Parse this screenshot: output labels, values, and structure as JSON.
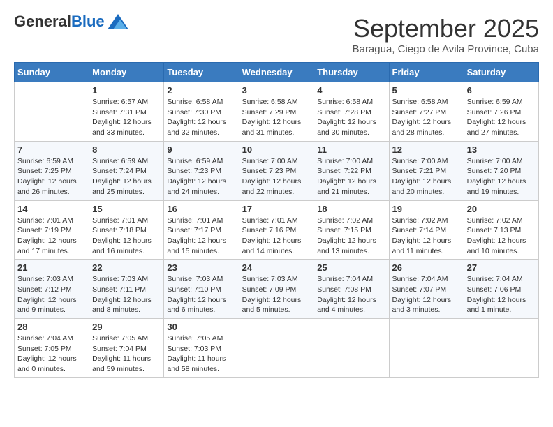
{
  "header": {
    "logo": {
      "general": "General",
      "blue": "Blue"
    },
    "title": "September 2025",
    "location": "Baragua, Ciego de Avila Province, Cuba"
  },
  "calendar": {
    "headers": [
      "Sunday",
      "Monday",
      "Tuesday",
      "Wednesday",
      "Thursday",
      "Friday",
      "Saturday"
    ],
    "weeks": [
      [
        {
          "day": "",
          "sunrise": "",
          "sunset": "",
          "daylight": ""
        },
        {
          "day": "1",
          "sunrise": "Sunrise: 6:57 AM",
          "sunset": "Sunset: 7:31 PM",
          "daylight": "Daylight: 12 hours and 33 minutes."
        },
        {
          "day": "2",
          "sunrise": "Sunrise: 6:58 AM",
          "sunset": "Sunset: 7:30 PM",
          "daylight": "Daylight: 12 hours and 32 minutes."
        },
        {
          "day": "3",
          "sunrise": "Sunrise: 6:58 AM",
          "sunset": "Sunset: 7:29 PM",
          "daylight": "Daylight: 12 hours and 31 minutes."
        },
        {
          "day": "4",
          "sunrise": "Sunrise: 6:58 AM",
          "sunset": "Sunset: 7:28 PM",
          "daylight": "Daylight: 12 hours and 30 minutes."
        },
        {
          "day": "5",
          "sunrise": "Sunrise: 6:58 AM",
          "sunset": "Sunset: 7:27 PM",
          "daylight": "Daylight: 12 hours and 28 minutes."
        },
        {
          "day": "6",
          "sunrise": "Sunrise: 6:59 AM",
          "sunset": "Sunset: 7:26 PM",
          "daylight": "Daylight: 12 hours and 27 minutes."
        }
      ],
      [
        {
          "day": "7",
          "sunrise": "Sunrise: 6:59 AM",
          "sunset": "Sunset: 7:25 PM",
          "daylight": "Daylight: 12 hours and 26 minutes."
        },
        {
          "day": "8",
          "sunrise": "Sunrise: 6:59 AM",
          "sunset": "Sunset: 7:24 PM",
          "daylight": "Daylight: 12 hours and 25 minutes."
        },
        {
          "day": "9",
          "sunrise": "Sunrise: 6:59 AM",
          "sunset": "Sunset: 7:23 PM",
          "daylight": "Daylight: 12 hours and 24 minutes."
        },
        {
          "day": "10",
          "sunrise": "Sunrise: 7:00 AM",
          "sunset": "Sunset: 7:23 PM",
          "daylight": "Daylight: 12 hours and 22 minutes."
        },
        {
          "day": "11",
          "sunrise": "Sunrise: 7:00 AM",
          "sunset": "Sunset: 7:22 PM",
          "daylight": "Daylight: 12 hours and 21 minutes."
        },
        {
          "day": "12",
          "sunrise": "Sunrise: 7:00 AM",
          "sunset": "Sunset: 7:21 PM",
          "daylight": "Daylight: 12 hours and 20 minutes."
        },
        {
          "day": "13",
          "sunrise": "Sunrise: 7:00 AM",
          "sunset": "Sunset: 7:20 PM",
          "daylight": "Daylight: 12 hours and 19 minutes."
        }
      ],
      [
        {
          "day": "14",
          "sunrise": "Sunrise: 7:01 AM",
          "sunset": "Sunset: 7:19 PM",
          "daylight": "Daylight: 12 hours and 17 minutes."
        },
        {
          "day": "15",
          "sunrise": "Sunrise: 7:01 AM",
          "sunset": "Sunset: 7:18 PM",
          "daylight": "Daylight: 12 hours and 16 minutes."
        },
        {
          "day": "16",
          "sunrise": "Sunrise: 7:01 AM",
          "sunset": "Sunset: 7:17 PM",
          "daylight": "Daylight: 12 hours and 15 minutes."
        },
        {
          "day": "17",
          "sunrise": "Sunrise: 7:01 AM",
          "sunset": "Sunset: 7:16 PM",
          "daylight": "Daylight: 12 hours and 14 minutes."
        },
        {
          "day": "18",
          "sunrise": "Sunrise: 7:02 AM",
          "sunset": "Sunset: 7:15 PM",
          "daylight": "Daylight: 12 hours and 13 minutes."
        },
        {
          "day": "19",
          "sunrise": "Sunrise: 7:02 AM",
          "sunset": "Sunset: 7:14 PM",
          "daylight": "Daylight: 12 hours and 11 minutes."
        },
        {
          "day": "20",
          "sunrise": "Sunrise: 7:02 AM",
          "sunset": "Sunset: 7:13 PM",
          "daylight": "Daylight: 12 hours and 10 minutes."
        }
      ],
      [
        {
          "day": "21",
          "sunrise": "Sunrise: 7:03 AM",
          "sunset": "Sunset: 7:12 PM",
          "daylight": "Daylight: 12 hours and 9 minutes."
        },
        {
          "day": "22",
          "sunrise": "Sunrise: 7:03 AM",
          "sunset": "Sunset: 7:11 PM",
          "daylight": "Daylight: 12 hours and 8 minutes."
        },
        {
          "day": "23",
          "sunrise": "Sunrise: 7:03 AM",
          "sunset": "Sunset: 7:10 PM",
          "daylight": "Daylight: 12 hours and 6 minutes."
        },
        {
          "day": "24",
          "sunrise": "Sunrise: 7:03 AM",
          "sunset": "Sunset: 7:09 PM",
          "daylight": "Daylight: 12 hours and 5 minutes."
        },
        {
          "day": "25",
          "sunrise": "Sunrise: 7:04 AM",
          "sunset": "Sunset: 7:08 PM",
          "daylight": "Daylight: 12 hours and 4 minutes."
        },
        {
          "day": "26",
          "sunrise": "Sunrise: 7:04 AM",
          "sunset": "Sunset: 7:07 PM",
          "daylight": "Daylight: 12 hours and 3 minutes."
        },
        {
          "day": "27",
          "sunrise": "Sunrise: 7:04 AM",
          "sunset": "Sunset: 7:06 PM",
          "daylight": "Daylight: 12 hours and 1 minute."
        }
      ],
      [
        {
          "day": "28",
          "sunrise": "Sunrise: 7:04 AM",
          "sunset": "Sunset: 7:05 PM",
          "daylight": "Daylight: 12 hours and 0 minutes."
        },
        {
          "day": "29",
          "sunrise": "Sunrise: 7:05 AM",
          "sunset": "Sunset: 7:04 PM",
          "daylight": "Daylight: 11 hours and 59 minutes."
        },
        {
          "day": "30",
          "sunrise": "Sunrise: 7:05 AM",
          "sunset": "Sunset: 7:03 PM",
          "daylight": "Daylight: 11 hours and 58 minutes."
        },
        {
          "day": "",
          "sunrise": "",
          "sunset": "",
          "daylight": ""
        },
        {
          "day": "",
          "sunrise": "",
          "sunset": "",
          "daylight": ""
        },
        {
          "day": "",
          "sunrise": "",
          "sunset": "",
          "daylight": ""
        },
        {
          "day": "",
          "sunrise": "",
          "sunset": "",
          "daylight": ""
        }
      ]
    ]
  }
}
